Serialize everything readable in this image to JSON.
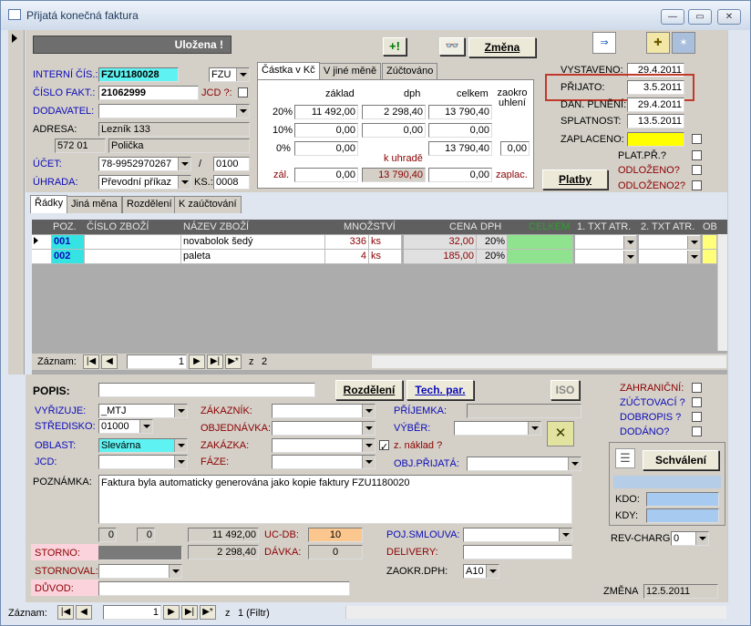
{
  "window": {
    "title": "Přijatá konečná faktura",
    "min": "—",
    "max": "▭",
    "close": "✕"
  },
  "header": {
    "status": "Uložena !",
    "btn_change": "Změna",
    "btn_platby": "Platby",
    "interni_lbl": "INTERNÍ ČÍS.:",
    "interni_val": "FZU1180028",
    "interni_type": "FZU",
    "cislo_lbl": "ČÍSLO FAKT.:",
    "cislo_val": "21062999",
    "jcd_lbl": "JCD ?:",
    "dodavatel_lbl": "DODAVATEL:",
    "dodavatel_val": "",
    "adresa_lbl": "ADRESA:",
    "adresa_val": "Lezník 133",
    "psc": "572 01",
    "mesto": "Polička",
    "ucet_lbl": "ÚČET:",
    "ucet_val": "78-9952970267",
    "ucet_kod": "0100",
    "slash": "/",
    "uhrada_lbl": "ÚHRADA:",
    "uhrada_val": "Převodní příkaz",
    "ks_lbl": "KS.:",
    "ks_val": "0008"
  },
  "amount_tabs": [
    "Částka v Kč",
    "V jiné měně",
    "Zúčtováno"
  ],
  "amounts": {
    "col_zaklad": "základ",
    "col_dph": "dph",
    "col_celkem": "celkem",
    "col_zaokr": "zaokro uhlení",
    "rows": [
      {
        "rate": "20%",
        "zaklad": "11 492,00",
        "dph": "2 298,40",
        "celkem": "13 790,40"
      },
      {
        "rate": "10%",
        "zaklad": "0,00",
        "dph": "0,00",
        "celkem": "0,00"
      },
      {
        "rate": "0%",
        "zaklad": "0,00",
        "dph": "",
        "celkem": "13 790,40"
      }
    ],
    "zaokr_val": "0,00",
    "k_uhrade_lbl": "k uhradě",
    "zal_lbl": "zál.",
    "zal_val": "0,00",
    "uhrade_val": "13 790,40",
    "zaplac_val": "0,00",
    "zaplac_lbl": "zaplac."
  },
  "dates": {
    "vystaveno_lbl": "VYSTAVENO:",
    "vystaveno": "29.4.2011",
    "prijato_lbl": "PŘIJATO:",
    "prijato": "3.5.2011",
    "dan_lbl": "DAN. PLNĚNÍ:",
    "dan": "29.4.2011",
    "splatnost_lbl": "SPLATNOST:",
    "splatnost": "13.5.2011",
    "zaplaceno_lbl": "ZAPLACENO:",
    "zaplaceno": "",
    "plat_lbl": "PLAT.PŘ.?",
    "odl1_lbl": "ODLOŽENO?",
    "odl2_lbl": "ODLOŽENO2?"
  },
  "detail_tabs": [
    "Řádky",
    "Jiná měna",
    "Rozdělení",
    "K zaúčtování"
  ],
  "grid": {
    "headers": [
      "POZ.",
      "ČÍSLO ZBOŽÍ",
      "NÁZEV ZBOŽÍ",
      "MNOŽSTVÍ",
      "CENA",
      "DPH",
      "CELKEM",
      "1. TXT ATR.",
      "2. TXT ATR.",
      "OB"
    ],
    "rows": [
      {
        "poz": "001",
        "cislo": "",
        "nazev": "novabolok šedý",
        "mnozstvi": "336",
        "jed": "ks",
        "cena": "32,00",
        "dph": "20%"
      },
      {
        "poz": "002",
        "cislo": "",
        "nazev": "paleta",
        "mnozstvi": "4",
        "jed": "ks",
        "cena": "185,00",
        "dph": "20%"
      }
    ],
    "nav_label": "Záznam:",
    "nav_current": "1",
    "nav_of": "z",
    "nav_total": "2"
  },
  "bottom": {
    "popis_lbl": "POPIS:",
    "popis_val": "",
    "btn_rozdeleni": "Rozdělení",
    "btn_tech": "Tech. par.",
    "btn_iso": "ISO",
    "zahranicni_lbl": "ZAHRANIČNÍ:",
    "zuctovaci_lbl": "ZÚČTOVACÍ ?",
    "dobropis_lbl": "DOBROPIS ?",
    "dodano_lbl": "DODÁNO?",
    "vyrizuje_lbl": "VYŘIZUJE:",
    "vyrizuje_val": "_MTJ",
    "stredisko_lbl": "STŘEDISKO:",
    "stredisko_val": "01000",
    "oblast_lbl": "OBLAST:",
    "oblast_val": "Slevárna",
    "jcd_lbl": "JCD:",
    "zakaznik_lbl": "ZÁKAZNÍK:",
    "objednavka_lbl": "OBJEDNÁVKA:",
    "zakazka_lbl": "ZAKÁZKA:",
    "faze_lbl": "FÁZE:",
    "znaklad_lbl": "z. náklad ?",
    "prijemka_lbl": "PŘÍJEMKA:",
    "vyber_lbl": "VÝBĚR:",
    "objprijata_lbl": "OBJ.PŘIJATÁ:",
    "btn_schvaleni": "Schválení",
    "kdo_lbl": "KDO:",
    "kdy_lbl": "KDY:",
    "poznamka_lbl": "POZNÁMKA:",
    "poznamka_val": "Faktura byla automaticky generována jako kopie faktury FZU1180020",
    "n0a": "0",
    "n0b": "0",
    "sum1": "11 492,00",
    "sum2": "2 298,40",
    "ucdb_lbl": "UC-DB:",
    "ucdb_val": "10",
    "davka_lbl": "DÁVKA:",
    "davka_val": "0",
    "pojsml_lbl": "POJ.SMLOUVA:",
    "delivery_lbl": "DELIVERY:",
    "zaokrdph_lbl": "ZAOKR.DPH:",
    "zaokrdph_val": "A10",
    "revcharg_lbl": "REV-CHARG:",
    "revcharg_val": "0",
    "storno_lbl": "STORNO:",
    "stornoval_lbl": "STORNOVAL:",
    "duvod_lbl": "DŮVOD:",
    "zmena_lbl": "ZMĚNA",
    "zmena_val": "12.5.2011"
  },
  "nav": {
    "label": "Záznam:",
    "current": "1",
    "of": "z",
    "total": "1 (Filtr)"
  }
}
